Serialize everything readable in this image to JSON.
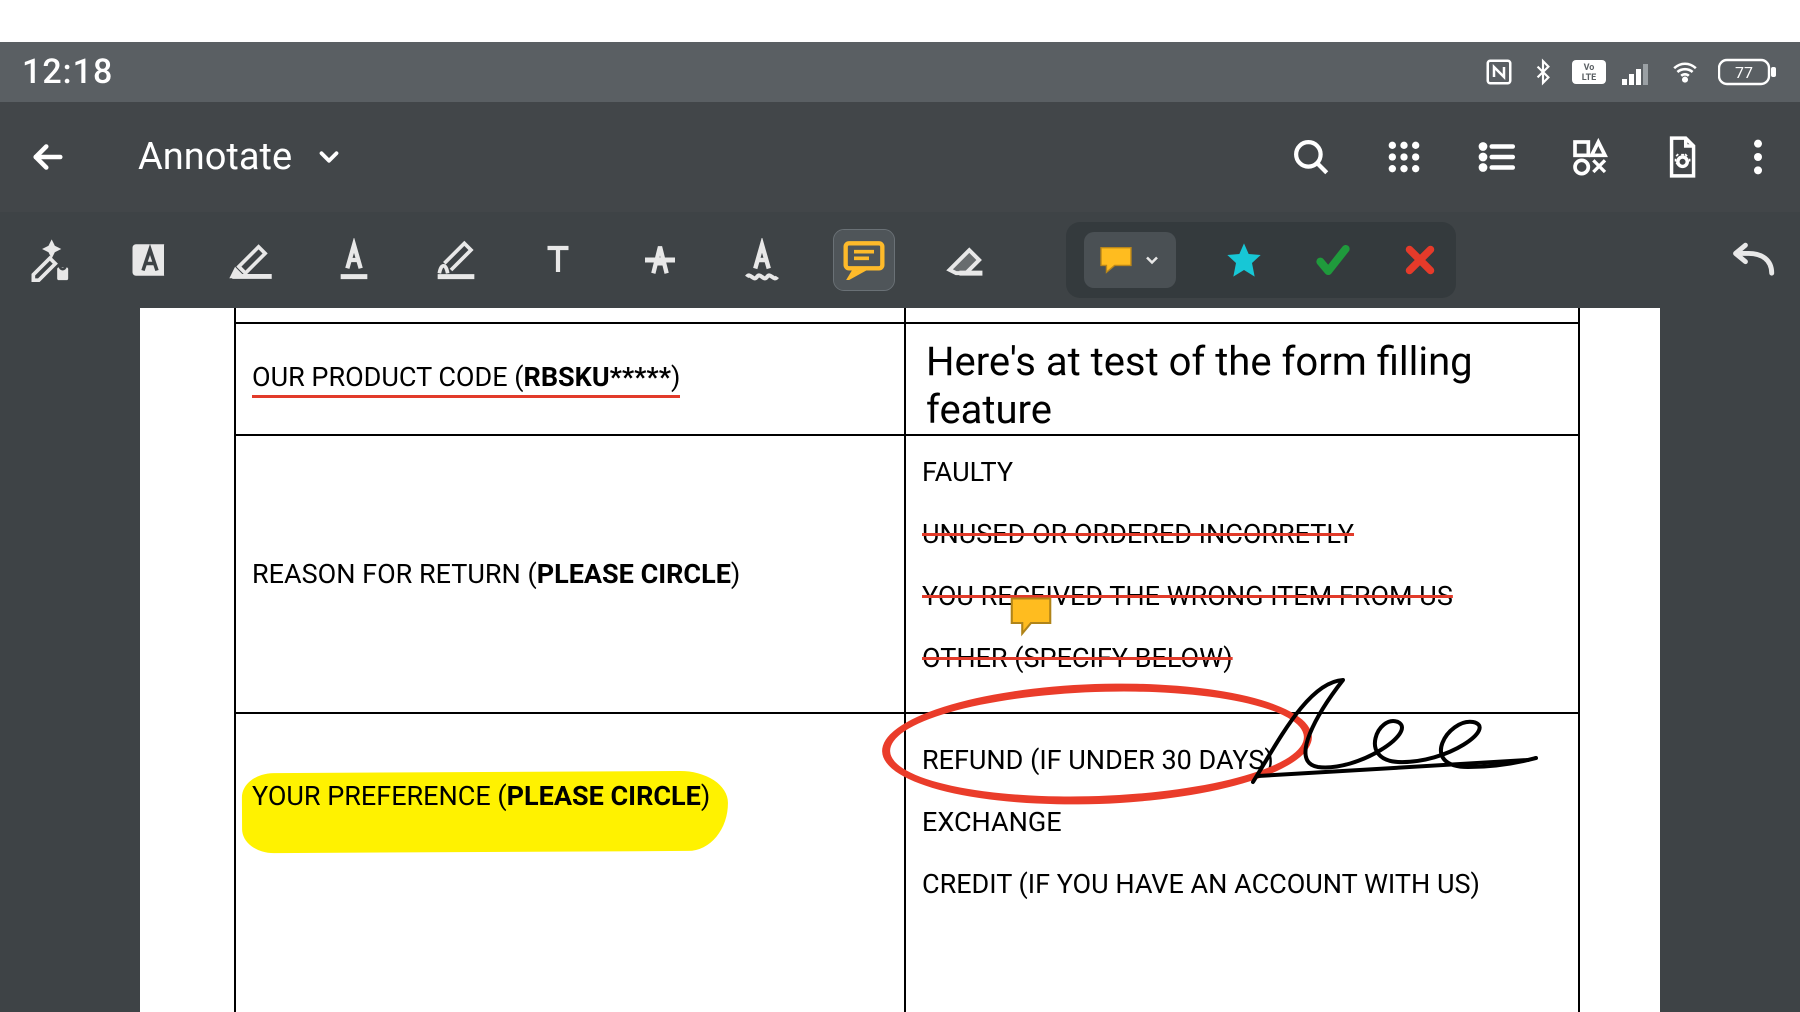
{
  "statusbar": {
    "time": "12:18",
    "battery": "77"
  },
  "appbar": {
    "title": "Annotate"
  },
  "toolbar": {
    "icons": {
      "magic": "auto-annotate",
      "textbox": "text-box",
      "highlighter": "highlighter",
      "underline": "underline",
      "draw": "free-draw",
      "text": "insert-text",
      "strike": "strikethrough",
      "squiggly": "squiggly-underline",
      "comment": "comment-note",
      "eraser": "eraser",
      "preset_comment": "comment",
      "preset_star": "star",
      "preset_check": "check",
      "preset_x": "cross",
      "undo": "undo"
    }
  },
  "document": {
    "row2_left_prefix": "OUR PRODUCT CODE (",
    "row2_left_bold": "RBSKU*****",
    "row2_left_suffix": ")",
    "row2_right_text": "Here's at test of the form filling feature",
    "row3_left_prefix": "REASON FOR RETURN (",
    "row3_left_bold": "PLEASE CIRCLE",
    "row3_left_suffix": ")",
    "row3_options": [
      {
        "text": "FAULTY",
        "struck": false
      },
      {
        "text": "UNUSED OR ORDERED INCORRETLY",
        "struck": true
      },
      {
        "text": "YOU RECEIVED THE WRONG ITEM FROM US",
        "struck": true
      },
      {
        "text": "OTHER (SPECIFY BELOW)",
        "struck": true
      }
    ],
    "row4_left_prefix": "YOUR PREFERENCE (",
    "row4_left_bold": "PLEASE CIRCLE",
    "row4_left_suffix": ")",
    "row4_options": [
      "REFUND (IF UNDER 30 DAYS)",
      "EXCHANGE",
      "CREDIT (IF YOU HAVE AN ACCOUNT WITH US)"
    ]
  }
}
